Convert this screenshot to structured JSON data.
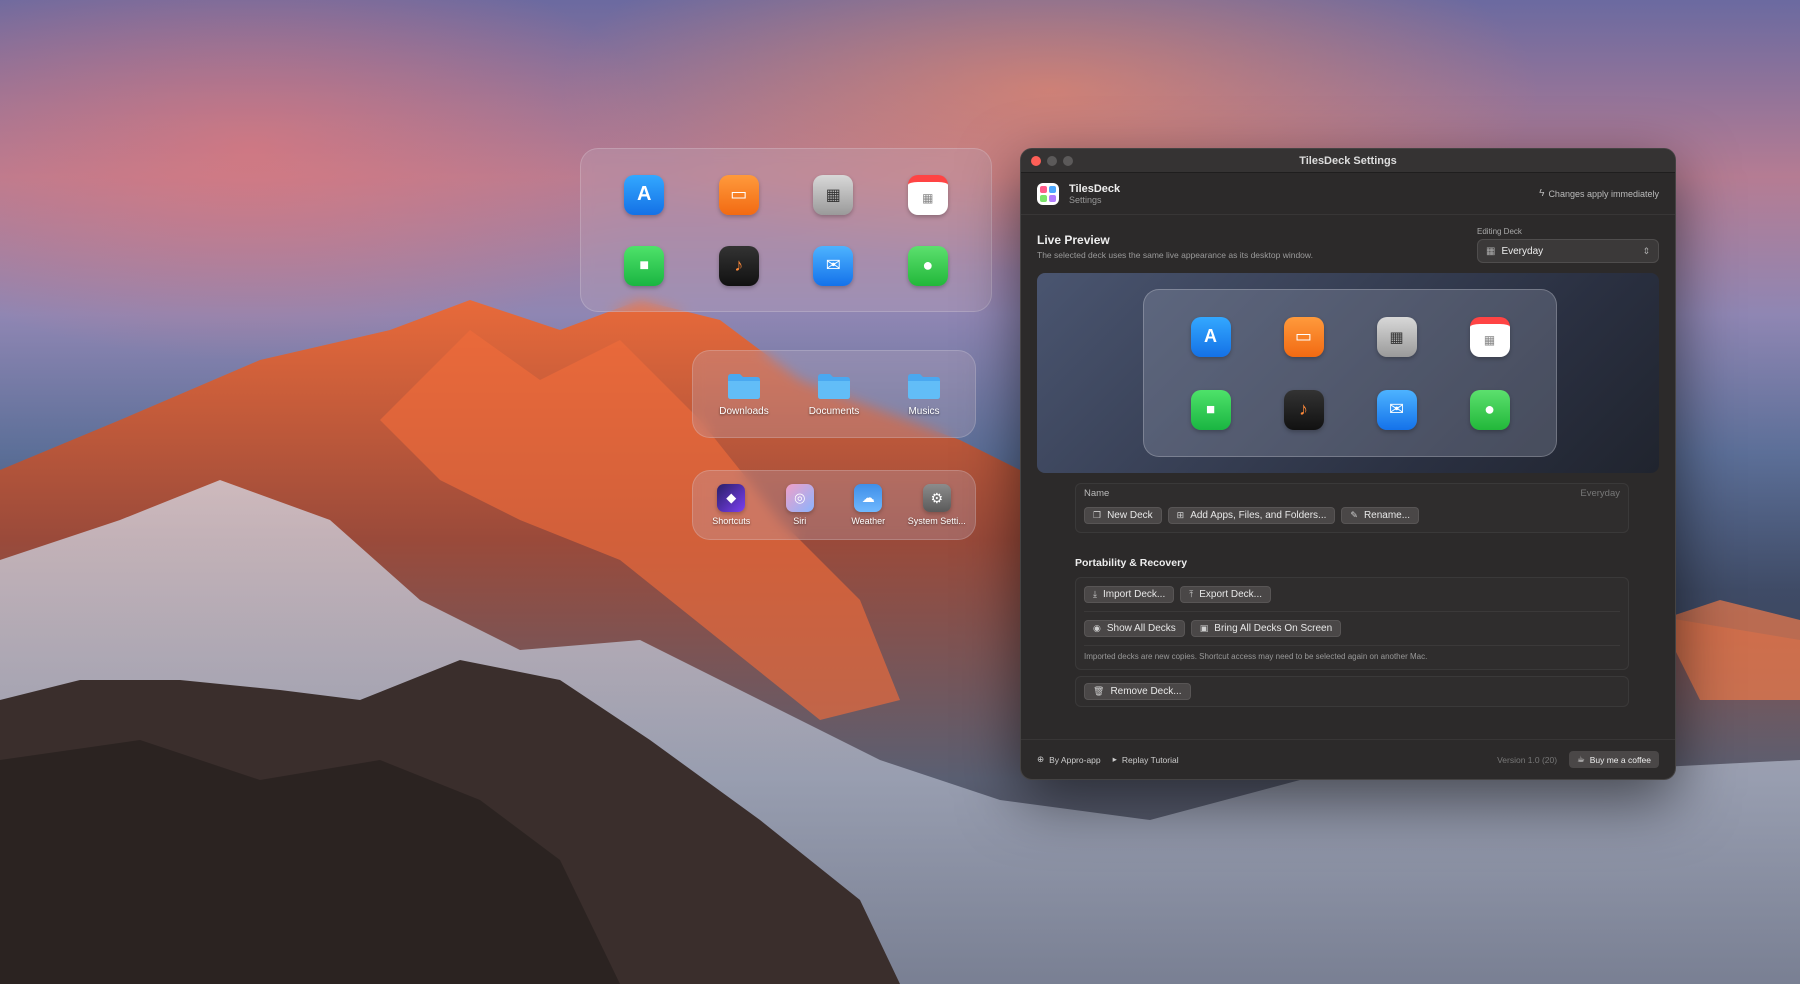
{
  "window": {
    "title": "TilesDeck Settings",
    "traffic_colors": [
      "#fe5f57",
      "#5c5a5a",
      "#5c5a5a"
    ]
  },
  "app": {
    "name": "TilesDeck",
    "subtitle": "Settings",
    "changes_note": "Changes apply immediately",
    "logo_colors": [
      "#ff5b8a",
      "#4ea8ff",
      "#7be36b",
      "#b27cff"
    ]
  },
  "preview": {
    "title": "Live Preview",
    "description": "The selected deck uses the same live appearance as its desktop window.",
    "editing_label": "Editing Deck",
    "editing_value": "Everyday"
  },
  "deck_section": {
    "name_label": "Name",
    "name_value": "Everyday",
    "buttons": {
      "new_deck": "New Deck",
      "add_items": "Add Apps, Files, and Folders...",
      "rename": "Rename..."
    }
  },
  "portability": {
    "title": "Portability & Recovery",
    "import": "Import Deck...",
    "export": "Export Deck...",
    "show_all": "Show All Decks",
    "bring_all": "Bring All Decks On Screen",
    "note": "Imported decks are new copies. Shortcut access may need to be selected again on another Mac.",
    "remove": "Remove Deck..."
  },
  "footer": {
    "by": "By Appro-app",
    "tutorial": "Replay Tutorial",
    "version": "Version 1.0 (20)",
    "coffee": "Buy me a coffee"
  },
  "desktop": {
    "folders_deck": [
      "Downloads",
      "Documents",
      "Musics"
    ],
    "system_deck": [
      "Shortcuts",
      "Siri",
      "Weather",
      "System Setti..."
    ]
  },
  "apps": [
    "app-store-icon",
    "books-icon",
    "calculator-icon",
    "calendar-icon",
    "facetime-icon",
    "garageband-icon",
    "mail-icon",
    "messages-icon"
  ]
}
